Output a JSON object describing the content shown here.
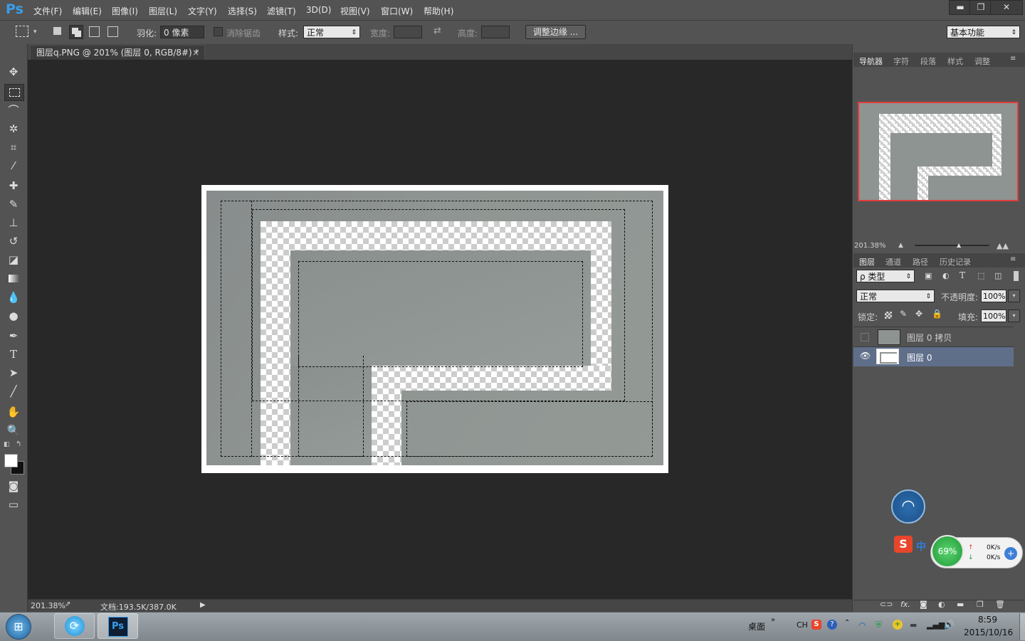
{
  "app": {
    "logo": "Ps"
  },
  "menu": [
    "文件(F)",
    "编辑(E)",
    "图像(I)",
    "图层(L)",
    "文字(Y)",
    "选择(S)",
    "滤镜(T)",
    "3D(D)",
    "视图(V)",
    "窗口(W)",
    "帮助(H)"
  ],
  "window_controls": {
    "minimize": "▬",
    "restore": "❐",
    "close": "✕"
  },
  "options": {
    "feather_label": "羽化:",
    "feather_value": "0 像素",
    "antialias_label": "消除锯齿",
    "style_label": "样式:",
    "style_value": "正常",
    "width_label": "宽度:",
    "height_label": "高度:",
    "refine_edge": "调整边缘 ...",
    "workspace": "基本功能"
  },
  "document": {
    "tab_title": "图层q.PNG @ 201% (图层 0, RGB/8#) *",
    "tab_close": "×"
  },
  "status": {
    "zoom": "201.38%",
    "doc_info": "文档:193.5K/387.0K"
  },
  "panels": {
    "top_tabs": [
      "导航器",
      "字符",
      "段落",
      "样式",
      "调整"
    ],
    "navigator_zoom": "201.38%",
    "layer_tabs": [
      "图层",
      "通道",
      "路径",
      "历史记录"
    ],
    "filter_kind": "ρ 类型",
    "blend_mode": "正常",
    "opacity_label": "不透明度:",
    "opacity_value": "100%",
    "lock_label": "锁定:",
    "fill_label": "填充:",
    "fill_value": "100%",
    "layers": [
      {
        "name": "图层 0 拷贝",
        "visible": false,
        "selected": false
      },
      {
        "name": "图层 0",
        "visible": true,
        "selected": true
      }
    ]
  },
  "overlay": {
    "battery_percent": "69%",
    "speed_up": "0K/s",
    "speed_down": "0K/s",
    "ime": "中"
  },
  "taskbar": {
    "desktop_label": "桌面",
    "lang": "CH",
    "time": "8:59",
    "date": "2015/10/16"
  },
  "colors": {
    "ps_blue": "#3a9eea",
    "panel_bg": "#535353",
    "canvas_bg": "#282828",
    "selection_row": "#5f6f8a",
    "nav_frame": "#e03c3c"
  }
}
